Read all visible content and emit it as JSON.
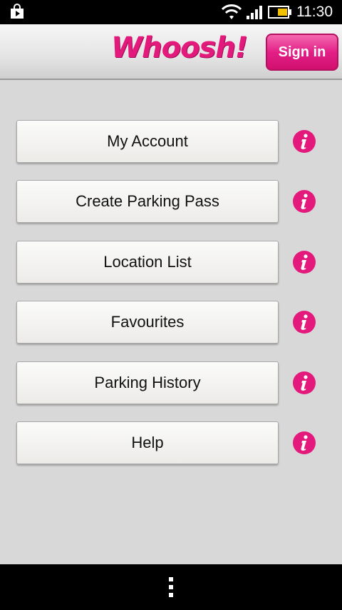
{
  "status_bar": {
    "time": "11:30",
    "icons": [
      "play-store-icon",
      "wifi-icon",
      "signal-icon",
      "battery-icon"
    ]
  },
  "header": {
    "logo_text": "Whoosh!",
    "sign_in_label": "Sign in",
    "accent_color": "#e3197b"
  },
  "menu": {
    "items": [
      {
        "label": "My Account",
        "icon": "info-icon"
      },
      {
        "label": "Create Parking Pass",
        "icon": "info-icon"
      },
      {
        "label": "Location List",
        "icon": "info-icon"
      },
      {
        "label": "Favourites",
        "icon": "info-icon"
      },
      {
        "label": "Parking History",
        "icon": "info-icon"
      },
      {
        "label": "Help",
        "icon": "info-icon"
      }
    ]
  },
  "navigation_bar": {
    "icons": [
      "overflow-menu-icon"
    ]
  }
}
